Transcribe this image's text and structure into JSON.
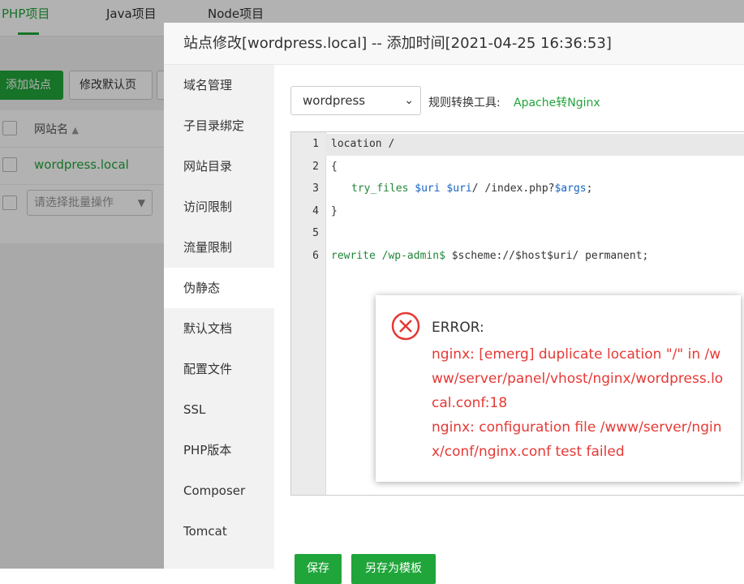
{
  "bg": {
    "tabs": [
      "PHP项目",
      "Java项目",
      "Node项目"
    ],
    "add_site": "添加站点",
    "modify_default": "修改默认页",
    "col_sitename": "网站名",
    "site_link": "wordpress.local",
    "batch_placeholder": "请选择批量操作"
  },
  "modal": {
    "title": "站点修改[wordpress.local] -- 添加时间[2021-04-25 16:36:53]",
    "side_items": [
      "域名管理",
      "子目录绑定",
      "网站目录",
      "访问限制",
      "流量限制",
      "伪静态",
      "默认文档",
      "配置文件",
      "SSL",
      "PHP版本",
      "Composer",
      "Tomcat"
    ],
    "active_index": 5,
    "template_select": "wordpress",
    "tool_label": "规则转换工具:",
    "tool_link": "Apache转Nginx",
    "line_numbers": [
      "1",
      "2",
      "3",
      "4",
      "5",
      "6"
    ],
    "code": {
      "l1": "location /",
      "l2": "{",
      "l3_kw": "try_files",
      "l3_v1": "$uri",
      "l3_v2": "$uri",
      "l3_a": "/ /index.php?",
      "l3_v3": "$args",
      "l3_end": ";",
      "l4": "}",
      "l6_kw": "rewrite",
      "l6_a": "/wp-admin$",
      "l6_b": " $scheme://$host$uri/ permanent;"
    },
    "save_button": "保存",
    "save_template_button": "另存为模板"
  },
  "error": {
    "title": "ERROR:",
    "lines": [
      "nginx: [emerg] duplicate location \"/\" in /www/server/panel/vhost/nginx/wordpress.local.conf:18",
      "nginx: configuration file /www/server/nginx/conf/nginx.conf test failed"
    ]
  },
  "colors": {
    "accent": "#20a53a",
    "error": "#e53935"
  }
}
